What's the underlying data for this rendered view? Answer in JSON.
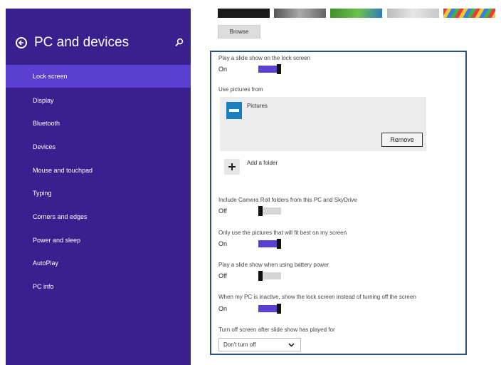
{
  "sidebar": {
    "title": "PC and devices",
    "items": [
      {
        "label": "Lock screen"
      },
      {
        "label": "Display"
      },
      {
        "label": "Bluetooth"
      },
      {
        "label": "Devices"
      },
      {
        "label": "Mouse and touchpad"
      },
      {
        "label": "Typing"
      },
      {
        "label": "Corners and edges"
      },
      {
        "label": "Power and sleep"
      },
      {
        "label": "AutoPlay"
      },
      {
        "label": "PC info"
      }
    ],
    "selected_item": "Lock screen",
    "background_color": "#3a1f8e",
    "selected_color": "#5b3fd1"
  },
  "background_thumbnails": [
    "black",
    "grey gradient",
    "green",
    "light grey",
    "colorful stripes"
  ],
  "browse_button": "Browse",
  "settings": {
    "slideshow": {
      "label": "Play a slide show on the lock screen",
      "state": "On"
    },
    "use_pictures_label": "Use pictures from",
    "pictures_folder": {
      "name": "Pictures",
      "remove_label": "Remove"
    },
    "add_folder_label": "Add a folder",
    "camera_roll": {
      "label": "Include Camera Roll folders from this PC and SkyDrive",
      "state": "Off"
    },
    "fit_screen": {
      "label": "Only use the pictures that will fit best on my screen",
      "state": "On"
    },
    "battery": {
      "label": "Play a slide show when using battery power",
      "state": "Off"
    },
    "inactive": {
      "label": "When my PC is inactive, show the lock screen instead of turning off the screen",
      "state": "On"
    },
    "turn_off": {
      "label": "Turn off screen after slide show has played for",
      "value": "Don't turn off"
    }
  },
  "colors": {
    "accent": "#5b3fd1",
    "panel_border": "#2b4f8f"
  }
}
